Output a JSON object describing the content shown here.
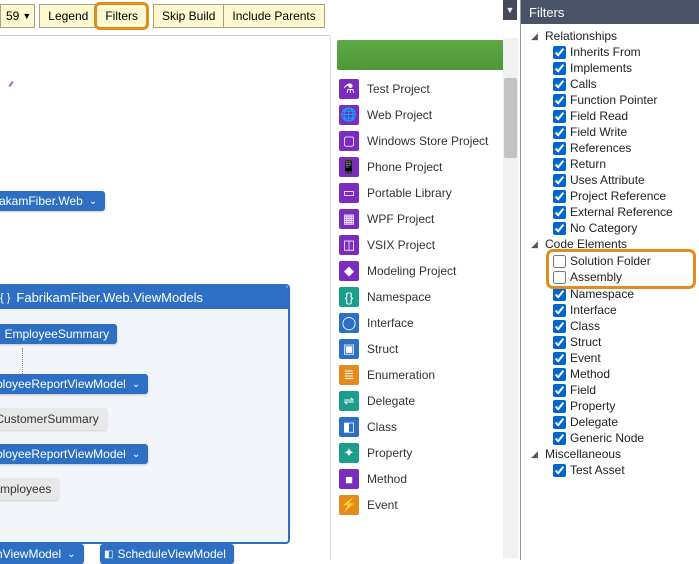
{
  "toolbar": {
    "zoom": "59",
    "legend": "Legend",
    "filters": "Filters",
    "skip_build": "Skip Build",
    "include_parents": "Include Parents"
  },
  "canvas": {
    "node1": "akamFiber.Web",
    "group_title": "FabrikamFiber.Web.ViewModels",
    "employee_summary": "EmployeeSummary",
    "report_vm1": "mployeeReportViewModel",
    "cust_summary": "tCustomerSummary",
    "report_vm2": "mployeeReportViewModel",
    "employees": "Employees",
    "bottom_vm": "nViewModel",
    "schedule_vm": "ScheduleViewModel"
  },
  "search_items": [
    {
      "icon": "flask",
      "color": "purple",
      "label": "Test Project"
    },
    {
      "icon": "globe",
      "color": "purple",
      "label": "Web Project"
    },
    {
      "icon": "window",
      "color": "purple",
      "label": "Windows Store Project"
    },
    {
      "icon": "phone",
      "color": "purple",
      "label": "Phone Project"
    },
    {
      "icon": "suitcase",
      "color": "purple",
      "label": "Portable Library"
    },
    {
      "icon": "app",
      "color": "purple",
      "label": "WPF Project"
    },
    {
      "icon": "box",
      "color": "purple",
      "label": "VSIX Project"
    },
    {
      "icon": "cube",
      "color": "purple",
      "label": "Modeling Project"
    },
    {
      "icon": "braces",
      "color": "teal",
      "label": "Namespace"
    },
    {
      "icon": "circle",
      "color": "blue",
      "label": "Interface"
    },
    {
      "icon": "struct",
      "color": "blue",
      "label": "Struct"
    },
    {
      "icon": "enum",
      "color": "orange",
      "label": "Enumeration"
    },
    {
      "icon": "delegate",
      "color": "teal",
      "label": "Delegate"
    },
    {
      "icon": "class",
      "color": "blue",
      "label": "Class"
    },
    {
      "icon": "wrench",
      "color": "teal",
      "label": "Property"
    },
    {
      "icon": "method",
      "color": "purple",
      "label": "Method"
    },
    {
      "icon": "event",
      "color": "orange",
      "label": "Event"
    }
  ],
  "filters": {
    "title": "Filters",
    "relationships_label": "Relationships",
    "relationships": [
      {
        "label": "Inherits From",
        "checked": true
      },
      {
        "label": "Implements",
        "checked": true
      },
      {
        "label": "Calls",
        "checked": true
      },
      {
        "label": "Function Pointer",
        "checked": true
      },
      {
        "label": "Field Read",
        "checked": true
      },
      {
        "label": "Field Write",
        "checked": true
      },
      {
        "label": "References",
        "checked": true
      },
      {
        "label": "Return",
        "checked": true
      },
      {
        "label": "Uses Attribute",
        "checked": true
      },
      {
        "label": "Project Reference",
        "checked": true
      },
      {
        "label": "External Reference",
        "checked": true
      },
      {
        "label": "No Category",
        "checked": true
      }
    ],
    "code_elements_label": "Code Elements",
    "code_elements": [
      {
        "label": "Solution Folder",
        "checked": false,
        "highlight": true
      },
      {
        "label": "Assembly",
        "checked": false,
        "highlight": true
      },
      {
        "label": "Namespace",
        "checked": true
      },
      {
        "label": "Interface",
        "checked": true
      },
      {
        "label": "Class",
        "checked": true
      },
      {
        "label": "Struct",
        "checked": true
      },
      {
        "label": "Event",
        "checked": true
      },
      {
        "label": "Method",
        "checked": true
      },
      {
        "label": "Field",
        "checked": true
      },
      {
        "label": "Property",
        "checked": true
      },
      {
        "label": "Delegate",
        "checked": true
      },
      {
        "label": "Generic Node",
        "checked": true
      }
    ],
    "misc_label": "Miscellaneous",
    "misc": [
      {
        "label": "Test Asset",
        "checked": true
      }
    ]
  }
}
